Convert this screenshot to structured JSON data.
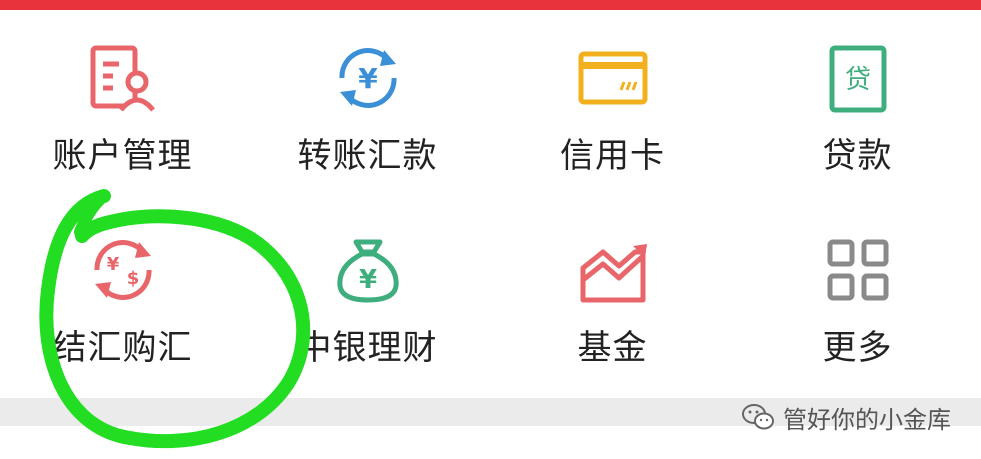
{
  "header": {
    "accent_color": "#e8323c"
  },
  "menu": {
    "items": [
      {
        "label": "账户管理",
        "icon": "account-management-icon",
        "color": "#e8656a"
      },
      {
        "label": "转账汇款",
        "icon": "transfer-remittance-icon",
        "color": "#3a8fd6"
      },
      {
        "label": "信用卡",
        "icon": "credit-card-icon",
        "color": "#f2b01e"
      },
      {
        "label": "贷款",
        "icon": "loan-icon",
        "color": "#3fae7e"
      },
      {
        "label": "结汇购汇",
        "icon": "currency-exchange-icon",
        "color": "#e8656a"
      },
      {
        "label": "中银理财",
        "icon": "money-bag-icon",
        "color": "#3fae7e"
      },
      {
        "label": "基金",
        "icon": "fund-chart-icon",
        "color": "#e8656a"
      },
      {
        "label": "更多",
        "icon": "more-grid-icon",
        "color": "#8a8a8a"
      }
    ]
  },
  "watermark": {
    "text": "管好你的小金库",
    "icon": "wechat-icon"
  },
  "annotation": {
    "color": "#22dd22",
    "target": "结汇购汇"
  }
}
